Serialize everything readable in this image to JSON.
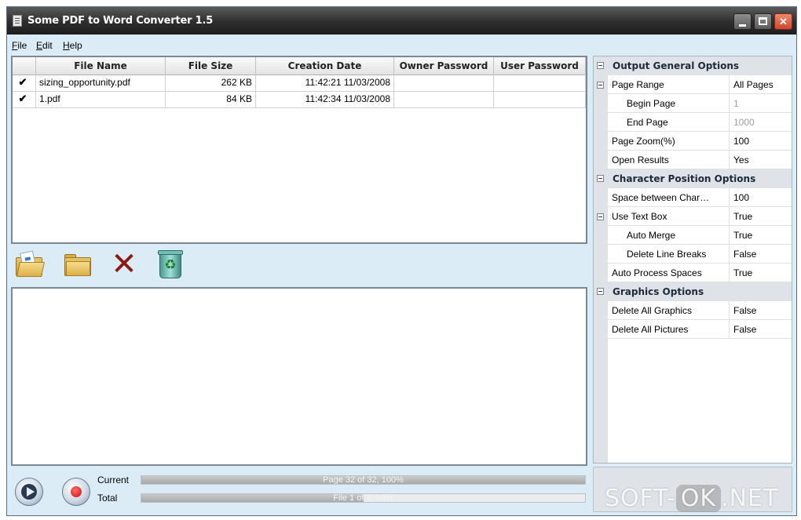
{
  "window": {
    "title": "Some PDF to Word Converter 1.5"
  },
  "menu": [
    {
      "label": "File",
      "u": "F",
      "rest": "ile"
    },
    {
      "label": "Edit",
      "u": "E",
      "rest": "dit"
    },
    {
      "label": "Help",
      "u": "H",
      "rest": "elp"
    }
  ],
  "grid": {
    "columns": [
      "File Name",
      "File Size",
      "Creation Date",
      "Owner Password",
      "User Password"
    ],
    "rows": [
      {
        "checked": "✔",
        "name": "sizing_opportunity.pdf",
        "size": "262 KB",
        "date": "11:42:21 11/03/2008",
        "owner": "",
        "user": ""
      },
      {
        "checked": "✔",
        "name": "1.pdf",
        "size": "84 KB",
        "date": "11:42:34 11/03/2008",
        "owner": "",
        "user": ""
      }
    ]
  },
  "toolbar": {
    "open_icon": "open-file-icon",
    "folder_icon": "add-folder-icon",
    "delete_icon": "delete-icon",
    "clear_icon": "recycle-bin-icon",
    "delete_glyph": "✕",
    "recycle_glyph": "♻"
  },
  "progress": {
    "current_label": "Current",
    "total_label": "Total",
    "current_text": "Page 32 of 32, 100%",
    "current_value": 1.0,
    "total_text": "File 1 of 2, 50%",
    "total_value": 0.5
  },
  "options": {
    "output_general": {
      "label": "Output General Options",
      "page_range": {
        "name": "Page Range",
        "value": "All Pages"
      },
      "begin_page": {
        "name": "Begin Page",
        "value": "1"
      },
      "end_page": {
        "name": "End Page",
        "value": "1000"
      },
      "page_zoom": {
        "name": "Page Zoom(%)",
        "value": "100"
      },
      "open_results": {
        "name": "Open Results",
        "value": "Yes"
      }
    },
    "character_position": {
      "label": "Character Position Options",
      "space_between": {
        "name": "Space between Char…",
        "value": "100"
      },
      "use_text_box": {
        "name": "Use Text Box",
        "value": "True"
      },
      "auto_merge": {
        "name": "Auto Merge",
        "value": "True"
      },
      "delete_line_breaks": {
        "name": "Delete Line Breaks",
        "value": "False"
      },
      "auto_process_spaces": {
        "name": "Auto Process Spaces",
        "value": "True"
      }
    },
    "graphics": {
      "label": "Graphics Options",
      "delete_all_graphics": {
        "name": "Delete All Graphics",
        "value": "False"
      },
      "delete_all_pictures": {
        "name": "Delete All Pictures",
        "value": "False"
      }
    }
  },
  "watermark": {
    "left": "SOFT-",
    "ok": "OK",
    "right": ".NET"
  },
  "colors": {
    "title_bar": "#2d2d2d",
    "window_bg": "#dcecf7",
    "close_button": "#d0462c"
  }
}
